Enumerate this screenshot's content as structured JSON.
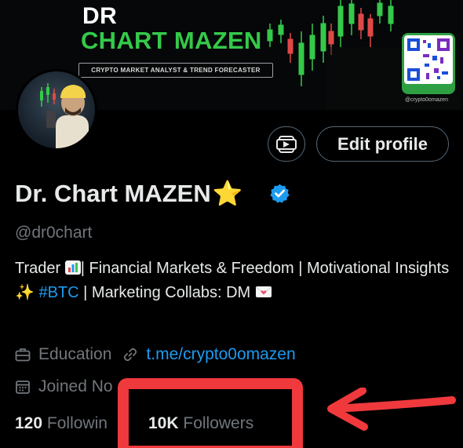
{
  "banner": {
    "title_line1": "DR",
    "title_line2": "CHART MAZEN",
    "tagline": "CRYPTO MARKET ANALYST & TREND FORECASTER",
    "qr_caption": "@crypto0omazen"
  },
  "profile": {
    "display_name": "Dr. Chart MAZEN",
    "name_emoji": "⭐",
    "handle": "@dr0chart",
    "edit_label": "Edit profile"
  },
  "bio": {
    "part1": "Trader ",
    "part2": "| Financial Markets & Freedom  | Motivational Insights ",
    "sparkle": "✨",
    "hashtag": "#BTC",
    "part3": " | Marketing Collabs: DM "
  },
  "meta": {
    "category": "Education",
    "link": "t.me/crypto0omazen",
    "joined": "Joined No"
  },
  "stats": {
    "following_count": "120",
    "following_label": "Followin",
    "followers_count": "10K",
    "followers_label": "Followers"
  },
  "colors": {
    "accent": "#1d9bf0",
    "annotation": "#f0393c",
    "banner_green": "#35c94a"
  }
}
